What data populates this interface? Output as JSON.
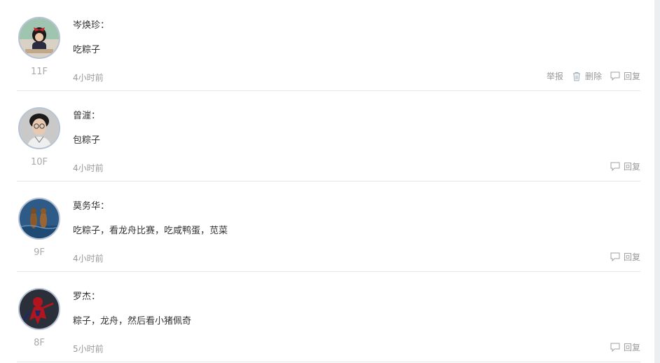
{
  "actions": {
    "report_label": "举报",
    "delete_label": "删除",
    "reply_label": "回复"
  },
  "comments": [
    {
      "author": "岑焕珍：",
      "text": "吃粽子",
      "floor": "11F",
      "time": "4小时前"
    },
    {
      "author": "曾漄：",
      "text": "包粽子",
      "floor": "10F",
      "time": "4小时前"
    },
    {
      "author": "莫务华：",
      "text": "吃粽子，看龙舟比赛，吃咸鸭蛋，苋菜",
      "floor": "9F",
      "time": "4小时前"
    },
    {
      "author": "罗杰：",
      "text": "粽子，龙舟，然后看小猪佩奇",
      "floor": "8F",
      "time": "5小时前"
    }
  ],
  "colors": {
    "text": "#333333",
    "muted": "#999999",
    "floor": "#aaaaaa",
    "avatar_border": "#b7c3d4",
    "divider": "#e6e6e6"
  }
}
